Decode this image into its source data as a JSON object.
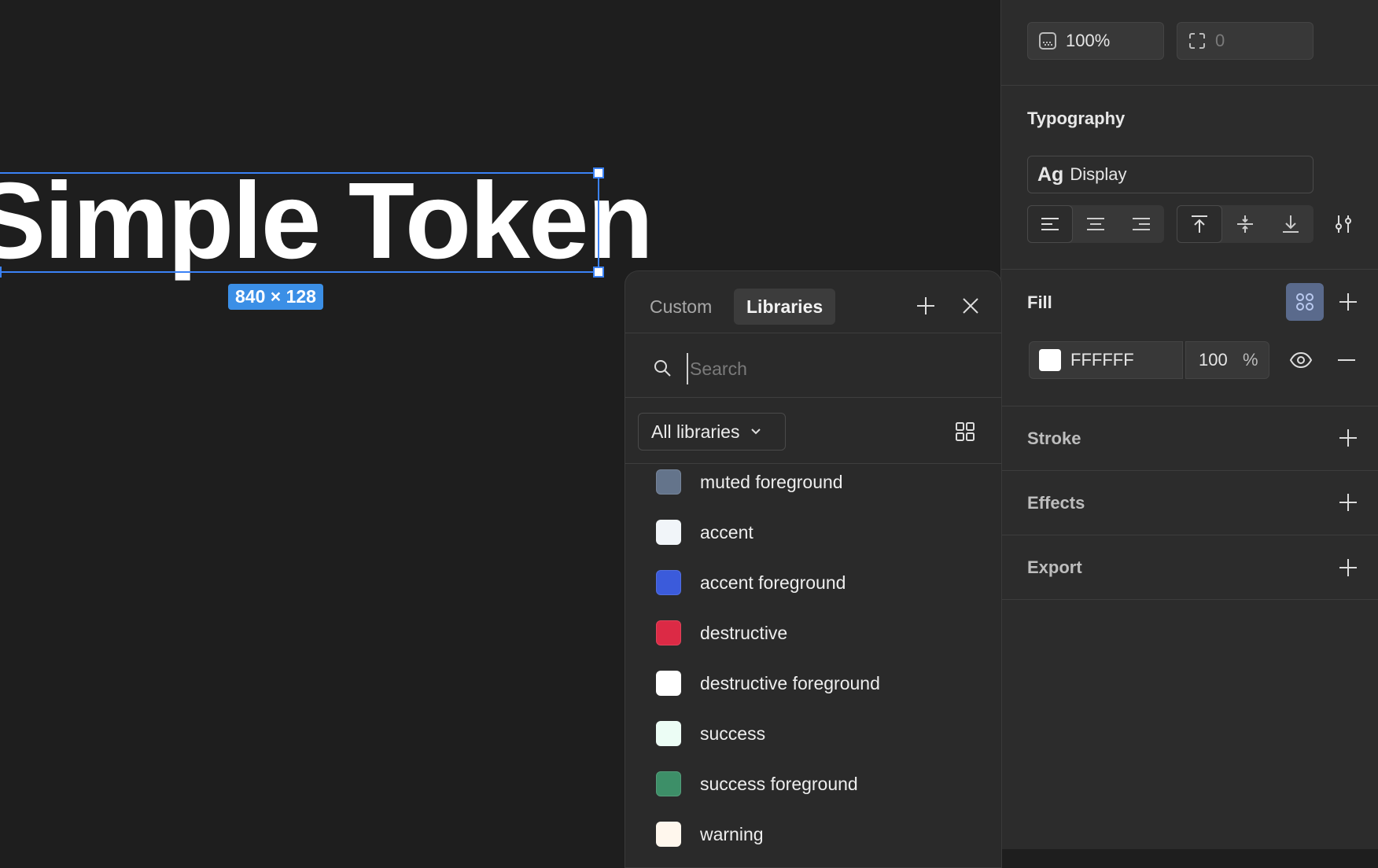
{
  "canvas": {
    "heading": "Simple Token",
    "size_badge": "840 × 128"
  },
  "props": {
    "opacity_value": "100%",
    "corner_value": "0",
    "typography_title": "Typography",
    "text_style_prefix": "Ag",
    "text_style_name": "Display",
    "fill_title": "Fill",
    "fill_hex": "FFFFFF",
    "fill_opacity": "100",
    "fill_opacity_unit": "%",
    "fill_color": "#FFFFFF",
    "stroke_title": "Stroke",
    "effects_title": "Effects",
    "export_title": "Export",
    "icons": {
      "opacity": "opacity-icon",
      "corner": "corner-radius-icon",
      "align": [
        "align-left-icon",
        "align-center-icon",
        "align-right-icon"
      ],
      "valign": [
        "align-top-icon",
        "align-middle-icon",
        "align-bottom-icon"
      ],
      "type_settings": "type-settings-icon",
      "style_grid": "style-grid-icon",
      "eye": "eye-icon",
      "remove": "minus-icon",
      "add": "plus-icon"
    }
  },
  "popup": {
    "tab_custom": "Custom",
    "tab_libraries": "Libraries",
    "search_placeholder": "Search",
    "library_filter": "All libraries",
    "swatches": [
      {
        "name": "muted foreground",
        "color": "#64748B"
      },
      {
        "name": "accent",
        "color": "#F1F5F9"
      },
      {
        "name": "accent foreground",
        "color": "#3B5BDB"
      },
      {
        "name": "destructive",
        "color": "#DC2A45"
      },
      {
        "name": "destructive foreground",
        "color": "#FFFFFF"
      },
      {
        "name": "success",
        "color": "#ECFDF5"
      },
      {
        "name": "success foreground",
        "color": "#3D8F68"
      },
      {
        "name": "warning",
        "color": "#FFF7ED"
      }
    ]
  },
  "colors": {
    "selection": "#3B82F6",
    "panel_bg": "#2C2C2C",
    "canvas_bg": "#1E1E1E",
    "style_active": "#5A6A8C"
  }
}
